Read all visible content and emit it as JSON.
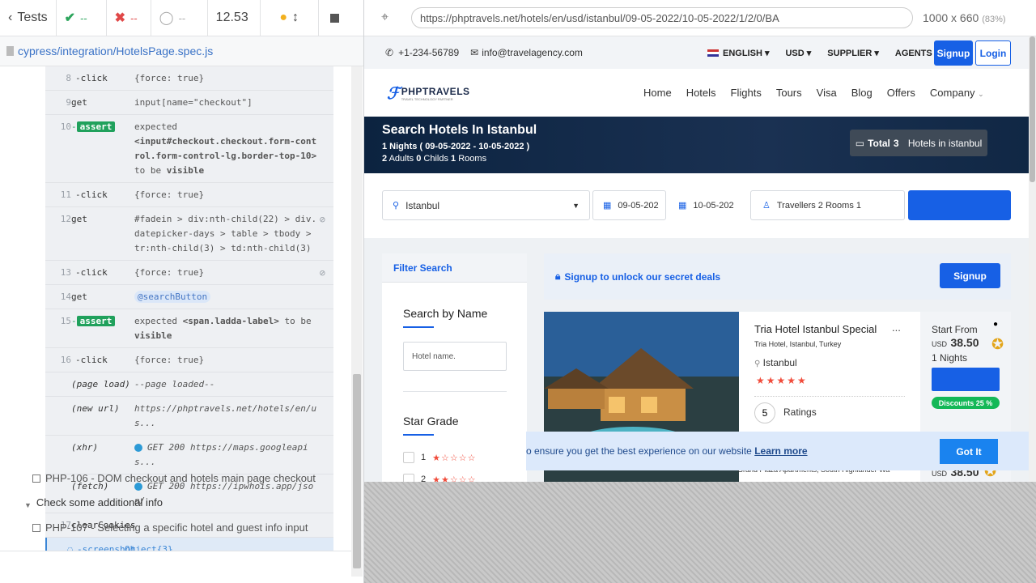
{
  "runner": {
    "tests_label": "Tests",
    "passed": "--",
    "failed": "--",
    "pending": "--",
    "duration": "12.53",
    "spec_path": "cypress/integration/HotelsPage.spec.js"
  },
  "command_log": [
    {
      "num": "8",
      "cmd": "-click",
      "msg": "{force: true}"
    },
    {
      "num": "9",
      "cmd": "get",
      "msg": "input[name=\"checkout\"]"
    },
    {
      "num": "10",
      "cmd": "assert",
      "msg_pre": "expected",
      "msg_sel": "<input#checkout.checkout.form-control.form-control-lg.border-top-10>",
      "msg_mid": "to be",
      "msg_post": "visible"
    },
    {
      "num": "11",
      "cmd": "-click",
      "msg": "{force: true}"
    },
    {
      "num": "12",
      "cmd": "get",
      "msg": "#fadein > div:nth-child(22) > div.datepicker-days > table > tbody > tr:nth-child(3) > td:nth-child(3)"
    },
    {
      "num": "13",
      "cmd": "-click",
      "msg": "{force: true}"
    },
    {
      "num": "14",
      "cmd": "get",
      "alias": "@searchButton"
    },
    {
      "num": "15",
      "cmd": "assert",
      "msg_pre": "expected",
      "msg_sel": "<span.ladda-label>",
      "msg_mid": "to be",
      "msg_post": "visible"
    },
    {
      "num": "16",
      "cmd": "-click",
      "msg": "{force: true}"
    },
    {
      "num": "",
      "cmd": "(page load)",
      "msg": "--page loaded--"
    },
    {
      "num": "",
      "cmd": "(new url)",
      "msg": "https://phptravels.net/hotels/en/us..."
    },
    {
      "num": "",
      "cmd": "(xhr)",
      "msg": "GET 200 https://maps.googleapis..."
    },
    {
      "num": "",
      "cmd": "(fetch)",
      "msg": "GET 200 https://ipwhois.app/json/"
    },
    {
      "num": "17",
      "cmd": "clearCookies",
      "msg": ""
    },
    {
      "num": "",
      "cmd": "-screenshot",
      "msg": "Object{3}"
    }
  ],
  "tests": [
    {
      "label": "PHP-106 - DOM checkout and hotels main page checkout"
    },
    {
      "label": "Check some additional info"
    },
    {
      "label": "PHP-107 - Selecting a specific hotel and guest info input"
    }
  ],
  "browser": {
    "url": "https://phptravels.net/hotels/en/usd/istanbul/09-05-2022/10-05-2022/1/2/0/BA",
    "size": "1000 x 660",
    "scale": "(83%)"
  },
  "site": {
    "phone": "+1-234-56789",
    "email": "info@travelagency.com",
    "language": "ENGLISH",
    "currency": "USD",
    "supplier": "SUPPLIER",
    "agents": "AGENTS",
    "signup": "Signup",
    "login": "Login",
    "logo": "PHPTRAVELS",
    "logo_sub": "TRAVEL TECHNOLOGY PARTNER",
    "nav": [
      "Home",
      "Hotels",
      "Flights",
      "Tours",
      "Visa",
      "Blog",
      "Offers",
      "Company"
    ],
    "hero_title": "Search Hotels In Istanbul",
    "nights_count": "1 Nights",
    "nights_dates": "( 09-05-2022 - 10-05-2022 )",
    "adults_count": "2",
    "adults_label": "Adults",
    "childs_count": "0",
    "childs_label": "Childs",
    "rooms_count": "1",
    "rooms_label": "Rooms",
    "total_label": "Total",
    "total_count": "3",
    "total_suffix": "Hotels in istanbul",
    "search_city": "Istanbul",
    "checkin": "09-05-202",
    "checkout": "10-05-202",
    "travellers": "Travellers 2 Rooms 1",
    "filter_title": "Filter Search",
    "search_by_name": "Search by Name",
    "hotel_name_placeholder": "Hotel name.",
    "star_grade": "Star Grade",
    "star_1": "1",
    "star_2": "2",
    "deals_text": "Signup to unlock our secret deals",
    "deals_btn": "Signup",
    "hotel_name": "Tria Hotel Istanbul Special",
    "hotel_more": "...",
    "hotel_address": "Tria Hotel, Istanbul, Turkey",
    "hotel_city": "Istanbul",
    "ratings_count": "5",
    "ratings_label": "Ratings",
    "start_from": "Start From",
    "price_currency": "USD",
    "price": "38.50",
    "price_nights": "1 Nights",
    "discount": "Discounts 25 %",
    "next_address": "Grand Plaza Apartments, South Highlander Wa",
    "next_price": "38.50",
    "cookie_text": "o ensure you get the best experience on our website",
    "cookie_link": "Learn more",
    "cookie_btn": "Got It"
  }
}
